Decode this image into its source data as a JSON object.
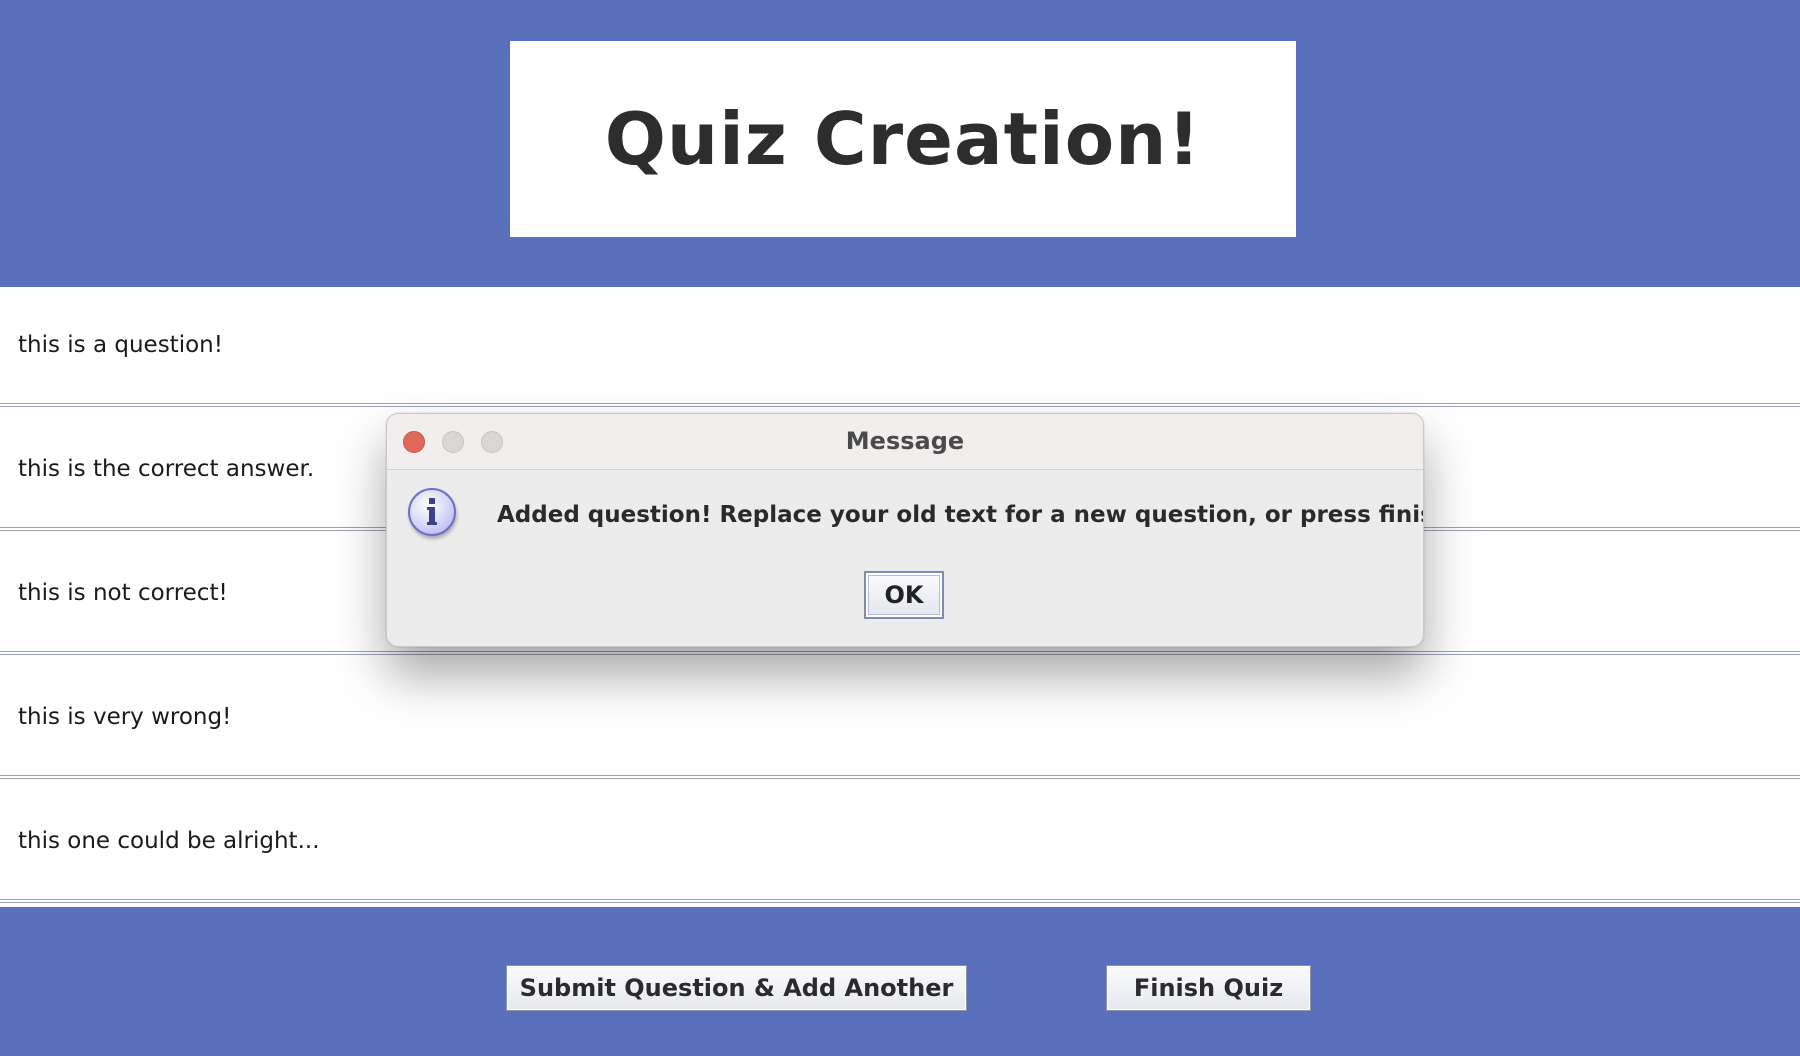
{
  "header": {
    "title": "Quiz Creation!"
  },
  "fields": [
    {
      "value": "this is a question!"
    },
    {
      "value": "this is the correct answer."
    },
    {
      "value": "this is not correct!"
    },
    {
      "value": "this is very wrong!"
    },
    {
      "value": "this one could be alright..."
    }
  ],
  "footer": {
    "submit_label": "Submit Question & Add Another",
    "finish_label": "Finish Quiz"
  },
  "dialog": {
    "title": "Message",
    "message": "Added question! Replace your old text for a new question, or press finish.",
    "ok_label": "OK",
    "icon": "info-icon"
  },
  "colors": {
    "background": "#5a70bc",
    "panel": "#ffffff",
    "close_button": "#e0685b"
  }
}
